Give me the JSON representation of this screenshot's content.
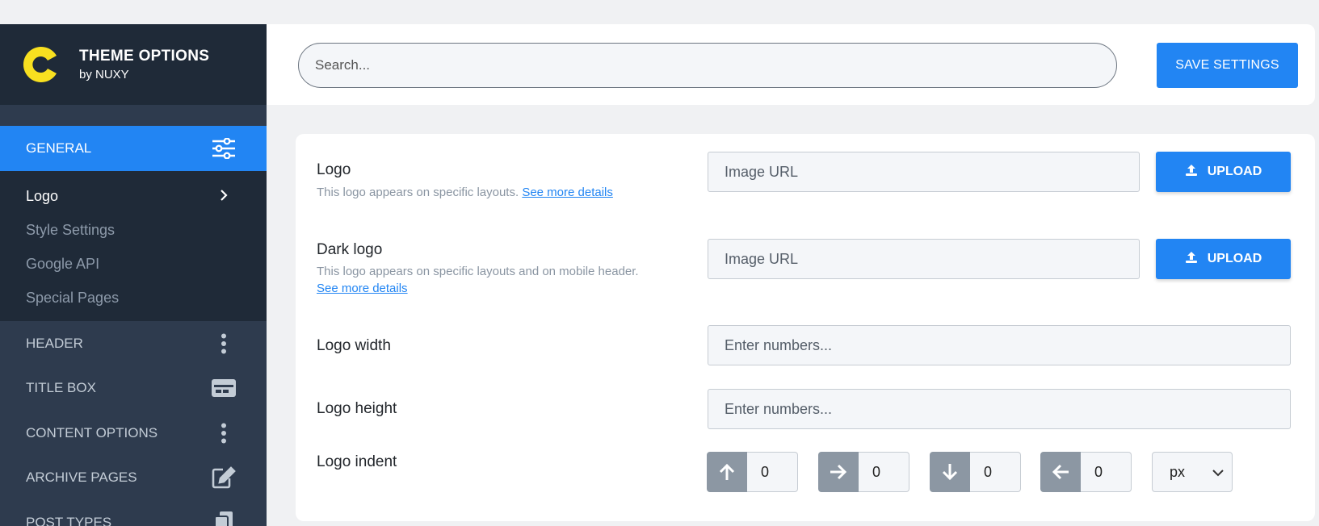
{
  "brand": {
    "title": "THEME OPTIONS",
    "subtitle": "by NUXY",
    "logo_icon": "c-logo-icon",
    "logo_color": "#f8e020"
  },
  "sidebar": {
    "active_section": {
      "label": "GENERAL",
      "icon": "sliders-icon"
    },
    "sub_items": [
      {
        "label": "Logo",
        "active": true,
        "icon": "chevron-right-icon"
      },
      {
        "label": "Style Settings",
        "active": false
      },
      {
        "label": "Google API",
        "active": false
      },
      {
        "label": "Special Pages",
        "active": false
      }
    ],
    "sections": [
      {
        "label": "HEADER",
        "icon": "more-vertical-icon"
      },
      {
        "label": "TITLE BOX",
        "icon": "card-icon"
      },
      {
        "label": "CONTENT OPTIONS",
        "icon": "more-vertical-icon"
      },
      {
        "label": "ARCHIVE PAGES",
        "icon": "edit-icon"
      },
      {
        "label": "POST TYPES",
        "icon": "copy-icon"
      }
    ]
  },
  "topbar": {
    "search_placeholder": "Search...",
    "save_label": "SAVE SETTINGS"
  },
  "fields": {
    "logo": {
      "label": "Logo",
      "description": "This logo appears on specific layouts.",
      "link": "See more details",
      "placeholder": "Image URL",
      "upload_label": "UPLOAD"
    },
    "dark_logo": {
      "label": "Dark logo",
      "description": "This logo appears on specific layouts and on mobile header.",
      "link": "See more details",
      "placeholder": "Image URL",
      "upload_label": "UPLOAD"
    },
    "logo_width": {
      "label": "Logo width",
      "placeholder": "Enter numbers..."
    },
    "logo_height": {
      "label": "Logo height",
      "placeholder": "Enter numbers..."
    },
    "logo_indent": {
      "label": "Logo indent",
      "values": [
        {
          "direction": "top",
          "icon": "arrow-up-icon",
          "value": "0"
        },
        {
          "direction": "right",
          "icon": "arrow-right-icon",
          "value": "0"
        },
        {
          "direction": "bottom",
          "icon": "arrow-down-icon",
          "value": "0"
        },
        {
          "direction": "left",
          "icon": "arrow-left-icon",
          "value": "0"
        }
      ],
      "unit": "px"
    }
  },
  "colors": {
    "accent": "#2285f3",
    "sidebar_bg": "#2e3b4e",
    "sidebar_dark": "#1f2a38"
  }
}
